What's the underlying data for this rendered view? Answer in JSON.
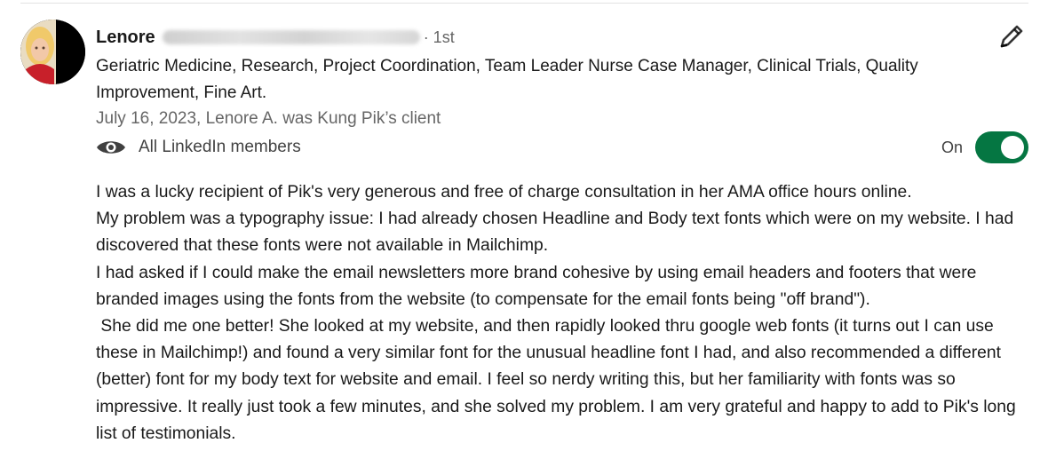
{
  "recommendation": {
    "author_first_name": "Lenore",
    "connection_degree": "· 1st",
    "headline": "Geriatric Medicine, Research, Project Coordination, Team Leader Nurse Case Manager, Clinical Trials, Quality Improvement, Fine Art.",
    "meta": "July 16, 2023, Lenore A. was Kung Pik’s client",
    "visibility_icon": "eye-icon",
    "visibility_label": "All LinkedIn members",
    "edit_icon": "pencil-icon",
    "toggle": {
      "label": "On",
      "state": "on",
      "color": "#057642"
    },
    "body_lines": [
      "I was a lucky recipient of Pik's very generous and free of charge consultation in her AMA office hours online.",
      "My problem was a typography issue: I had already chosen Headline and Body text fonts which were on my website. I had discovered that these fonts were not available in Mailchimp.",
      "I had asked if I could make the email newsletters more brand cohesive by using email headers and footers that were branded images using the fonts from the website (to compensate for the email fonts being \"off brand\").",
      " She did me one better! She looked at my website, and then rapidly looked thru google web fonts (it turns out I can use these in Mailchimp!) and found a very similar font for the unusual headline font I had, and also recommended a different (better) font for my body text for website and email. I feel so nerdy writing this, but her familiarity with fonts was so impressive. It really just took a few minutes, and she solved my problem. I am very grateful and happy to add to Pik's long list of testimonials."
    ]
  }
}
